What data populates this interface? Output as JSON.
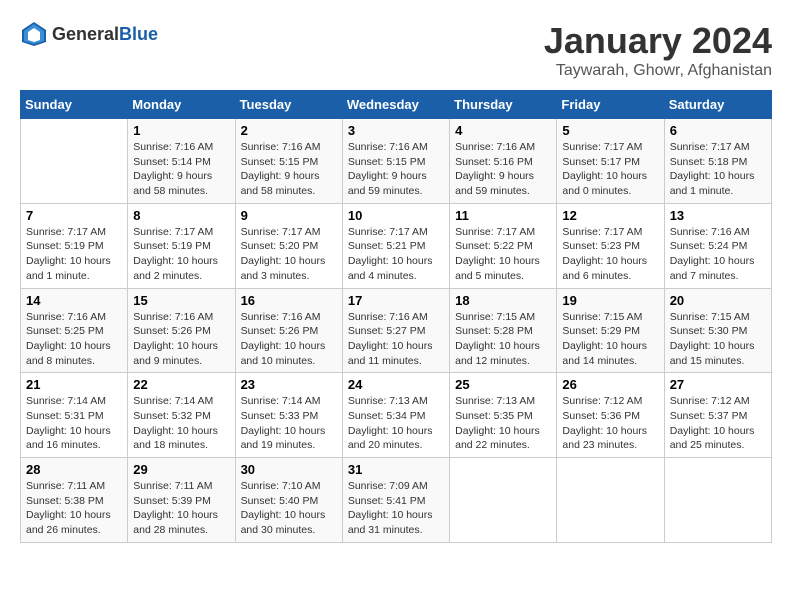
{
  "header": {
    "logo_general": "General",
    "logo_blue": "Blue",
    "month": "January 2024",
    "location": "Taywarah, Ghowr, Afghanistan"
  },
  "days_of_week": [
    "Sunday",
    "Monday",
    "Tuesday",
    "Wednesday",
    "Thursday",
    "Friday",
    "Saturday"
  ],
  "weeks": [
    [
      {
        "day": "",
        "details": ""
      },
      {
        "day": "1",
        "details": "Sunrise: 7:16 AM\nSunset: 5:14 PM\nDaylight: 9 hours\nand 58 minutes."
      },
      {
        "day": "2",
        "details": "Sunrise: 7:16 AM\nSunset: 5:15 PM\nDaylight: 9 hours\nand 58 minutes."
      },
      {
        "day": "3",
        "details": "Sunrise: 7:16 AM\nSunset: 5:15 PM\nDaylight: 9 hours\nand 59 minutes."
      },
      {
        "day": "4",
        "details": "Sunrise: 7:16 AM\nSunset: 5:16 PM\nDaylight: 9 hours\nand 59 minutes."
      },
      {
        "day": "5",
        "details": "Sunrise: 7:17 AM\nSunset: 5:17 PM\nDaylight: 10 hours\nand 0 minutes."
      },
      {
        "day": "6",
        "details": "Sunrise: 7:17 AM\nSunset: 5:18 PM\nDaylight: 10 hours\nand 1 minute."
      }
    ],
    [
      {
        "day": "7",
        "details": "Sunrise: 7:17 AM\nSunset: 5:19 PM\nDaylight: 10 hours\nand 1 minute."
      },
      {
        "day": "8",
        "details": "Sunrise: 7:17 AM\nSunset: 5:19 PM\nDaylight: 10 hours\nand 2 minutes."
      },
      {
        "day": "9",
        "details": "Sunrise: 7:17 AM\nSunset: 5:20 PM\nDaylight: 10 hours\nand 3 minutes."
      },
      {
        "day": "10",
        "details": "Sunrise: 7:17 AM\nSunset: 5:21 PM\nDaylight: 10 hours\nand 4 minutes."
      },
      {
        "day": "11",
        "details": "Sunrise: 7:17 AM\nSunset: 5:22 PM\nDaylight: 10 hours\nand 5 minutes."
      },
      {
        "day": "12",
        "details": "Sunrise: 7:17 AM\nSunset: 5:23 PM\nDaylight: 10 hours\nand 6 minutes."
      },
      {
        "day": "13",
        "details": "Sunrise: 7:16 AM\nSunset: 5:24 PM\nDaylight: 10 hours\nand 7 minutes."
      }
    ],
    [
      {
        "day": "14",
        "details": "Sunrise: 7:16 AM\nSunset: 5:25 PM\nDaylight: 10 hours\nand 8 minutes."
      },
      {
        "day": "15",
        "details": "Sunrise: 7:16 AM\nSunset: 5:26 PM\nDaylight: 10 hours\nand 9 minutes."
      },
      {
        "day": "16",
        "details": "Sunrise: 7:16 AM\nSunset: 5:26 PM\nDaylight: 10 hours\nand 10 minutes."
      },
      {
        "day": "17",
        "details": "Sunrise: 7:16 AM\nSunset: 5:27 PM\nDaylight: 10 hours\nand 11 minutes."
      },
      {
        "day": "18",
        "details": "Sunrise: 7:15 AM\nSunset: 5:28 PM\nDaylight: 10 hours\nand 12 minutes."
      },
      {
        "day": "19",
        "details": "Sunrise: 7:15 AM\nSunset: 5:29 PM\nDaylight: 10 hours\nand 14 minutes."
      },
      {
        "day": "20",
        "details": "Sunrise: 7:15 AM\nSunset: 5:30 PM\nDaylight: 10 hours\nand 15 minutes."
      }
    ],
    [
      {
        "day": "21",
        "details": "Sunrise: 7:14 AM\nSunset: 5:31 PM\nDaylight: 10 hours\nand 16 minutes."
      },
      {
        "day": "22",
        "details": "Sunrise: 7:14 AM\nSunset: 5:32 PM\nDaylight: 10 hours\nand 18 minutes."
      },
      {
        "day": "23",
        "details": "Sunrise: 7:14 AM\nSunset: 5:33 PM\nDaylight: 10 hours\nand 19 minutes."
      },
      {
        "day": "24",
        "details": "Sunrise: 7:13 AM\nSunset: 5:34 PM\nDaylight: 10 hours\nand 20 minutes."
      },
      {
        "day": "25",
        "details": "Sunrise: 7:13 AM\nSunset: 5:35 PM\nDaylight: 10 hours\nand 22 minutes."
      },
      {
        "day": "26",
        "details": "Sunrise: 7:12 AM\nSunset: 5:36 PM\nDaylight: 10 hours\nand 23 minutes."
      },
      {
        "day": "27",
        "details": "Sunrise: 7:12 AM\nSunset: 5:37 PM\nDaylight: 10 hours\nand 25 minutes."
      }
    ],
    [
      {
        "day": "28",
        "details": "Sunrise: 7:11 AM\nSunset: 5:38 PM\nDaylight: 10 hours\nand 26 minutes."
      },
      {
        "day": "29",
        "details": "Sunrise: 7:11 AM\nSunset: 5:39 PM\nDaylight: 10 hours\nand 28 minutes."
      },
      {
        "day": "30",
        "details": "Sunrise: 7:10 AM\nSunset: 5:40 PM\nDaylight: 10 hours\nand 30 minutes."
      },
      {
        "day": "31",
        "details": "Sunrise: 7:09 AM\nSunset: 5:41 PM\nDaylight: 10 hours\nand 31 minutes."
      },
      {
        "day": "",
        "details": ""
      },
      {
        "day": "",
        "details": ""
      },
      {
        "day": "",
        "details": ""
      }
    ]
  ]
}
